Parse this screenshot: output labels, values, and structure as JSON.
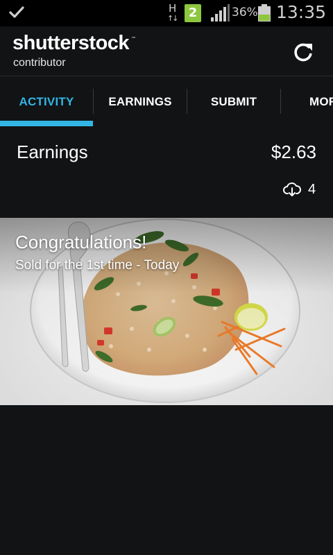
{
  "status_bar": {
    "network_type": "H",
    "notification_count": "2",
    "battery_percent": "36%",
    "time": "13:35",
    "icons": [
      "check-icon",
      "network-h-icon",
      "signal-icon",
      "battery-icon"
    ],
    "battery_level": 0.36
  },
  "header": {
    "logo_text": "shutterstock",
    "logo_tm": "™",
    "logo_subtitle": "contributor",
    "refresh_icon": "refresh-icon"
  },
  "tabs": [
    {
      "label": "ACTIVITY",
      "active": true
    },
    {
      "label": "EARNINGS",
      "active": false
    },
    {
      "label": "SUBMIT",
      "active": false
    },
    {
      "label": "MORE",
      "active": false
    }
  ],
  "earnings": {
    "label": "Earnings",
    "amount": "$2.63",
    "downloads": "4",
    "download_icon": "cloud-download-icon"
  },
  "activity_card": {
    "title": "Congratulations!",
    "subtitle": "Sold for the 1st time - Today"
  },
  "colors": {
    "accent": "#33b5e5",
    "background": "#111315",
    "badge_green": "#8dc63f"
  }
}
